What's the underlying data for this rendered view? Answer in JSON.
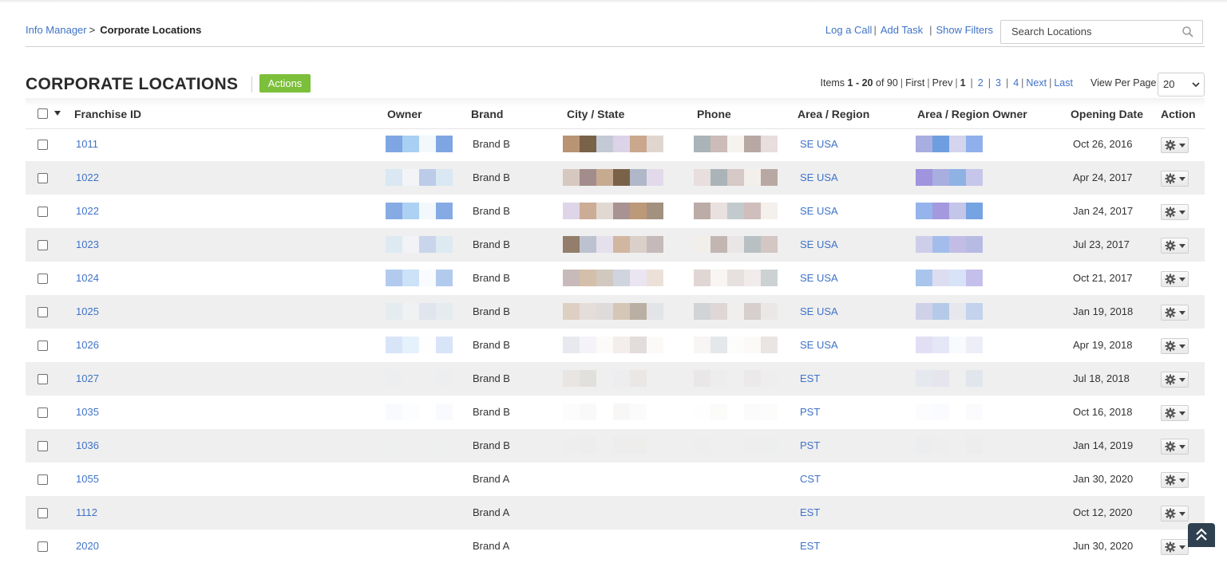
{
  "breadcrumb": {
    "parent": "Info Manager",
    "separator": ">",
    "current": "Corporate Locations"
  },
  "toolbar": {
    "log_call": "Log a Call",
    "add_task": "Add Task",
    "show_filters": "Show Filters",
    "sep": "|"
  },
  "search": {
    "placeholder": "Search Locations",
    "icon": "search-icon"
  },
  "page": {
    "title": "CORPORATE LOCATIONS",
    "actions_label": "Actions",
    "actions_color": "#7cbf3a"
  },
  "pager": {
    "items_label": "Items",
    "range": "1 - 20",
    "of_label": "of",
    "total": "90",
    "first": "First",
    "prev": "Prev",
    "current": "1",
    "pages": [
      "2",
      "3",
      "4"
    ],
    "next": "Next",
    "last": "Last",
    "view_per_page_label": "View Per Page",
    "per_page": "20"
  },
  "table": {
    "columns": {
      "franchise_id": "Franchise ID",
      "owner": "Owner",
      "brand": "Brand",
      "city_state": "City /  State",
      "phone": "Phone",
      "area_region": "Area / Region",
      "area_region_owner": "Area / Region Owner",
      "opening_date": "Opening Date",
      "action": "Action"
    },
    "rows": [
      {
        "id": "1011",
        "brand": "Brand B",
        "region": "SE USA",
        "date": "Oct 26, 2016"
      },
      {
        "id": "1022",
        "brand": "Brand B",
        "region": "SE USA",
        "date": "Apr 24, 2017"
      },
      {
        "id": "1022",
        "brand": "Brand B",
        "region": "SE USA",
        "date": "Jan 24, 2017"
      },
      {
        "id": "1023",
        "brand": "Brand B",
        "region": "SE USA",
        "date": "Jul 23, 2017"
      },
      {
        "id": "1024",
        "brand": "Brand B",
        "region": "SE USA",
        "date": "Oct 21, 2017"
      },
      {
        "id": "1025",
        "brand": "Brand B",
        "region": "SE USA",
        "date": "Jan 19, 2018"
      },
      {
        "id": "1026",
        "brand": "Brand B",
        "region": "SE USA",
        "date": "Apr 19, 2018"
      },
      {
        "id": "1027",
        "brand": "Brand B",
        "region": "EST",
        "date": "Jul 18, 2018"
      },
      {
        "id": "1035",
        "brand": "Brand B",
        "region": "PST",
        "date": "Oct 16, 2018"
      },
      {
        "id": "1036",
        "brand": "Brand B",
        "region": "PST",
        "date": "Jan 14, 2019"
      },
      {
        "id": "1055",
        "brand": "Brand A",
        "region": "CST",
        "date": "Jan 30, 2020"
      },
      {
        "id": "1112",
        "brand": "Brand A",
        "region": "EST",
        "date": "Oct 12, 2020"
      },
      {
        "id": "2020",
        "brand": "Brand A",
        "region": "EST",
        "date": "Jun 30, 2020"
      }
    ],
    "action_icon": "gear-icon"
  },
  "colors": {
    "link": "#3f73c7",
    "row_alt": "#efefef",
    "scroll_top_bg": "#2f4050"
  }
}
